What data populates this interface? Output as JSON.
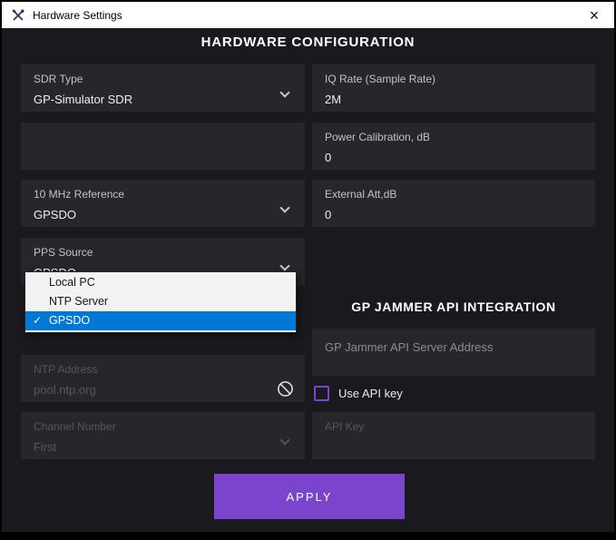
{
  "window": {
    "title": "Hardware Settings",
    "close_glyph": "×"
  },
  "header": {
    "title": "HARDWARE CONFIGURATION"
  },
  "left": {
    "sdr_type": {
      "label": "SDR Type",
      "value": "GP-Simulator SDR"
    },
    "reference": {
      "label": "10 MHz Reference",
      "value": "GPSDO"
    },
    "pps_source": {
      "label": "PPS Source",
      "value": "GPSDO"
    },
    "ntp_address": {
      "label": "NTP Address",
      "value": "pool.ntp.org"
    },
    "channel_number": {
      "label": "Channel Number",
      "value": "First"
    }
  },
  "right": {
    "iq_rate": {
      "label": "IQ Rate (Sample Rate)",
      "value": "2M"
    },
    "power_calibration": {
      "label": "Power Calibration, dB",
      "value": "0"
    },
    "external_att": {
      "label": "External Att,dB",
      "value": "0"
    },
    "api_section_title": "GP JAMMER API INTEGRATION",
    "api_server": {
      "placeholder": "GP Jammer API Server Address"
    },
    "use_api_key": {
      "label": "Use API key",
      "checked": false
    },
    "api_key": {
      "placeholder": "API Key"
    }
  },
  "pps_dropdown": {
    "checkmark": "✓",
    "items": [
      {
        "label": "Local PC",
        "selected": false
      },
      {
        "label": "NTP Server",
        "selected": false
      },
      {
        "label": "GPSDO",
        "selected": true
      }
    ]
  },
  "apply_button": {
    "label": "APPLY"
  },
  "colors": {
    "accent_purple": "#7b44cd",
    "selection_blue": "#0078d7",
    "body_bg": "#1a1a1e",
    "field_bg": "#26262b",
    "titlebar_bg": "#ffffff"
  }
}
